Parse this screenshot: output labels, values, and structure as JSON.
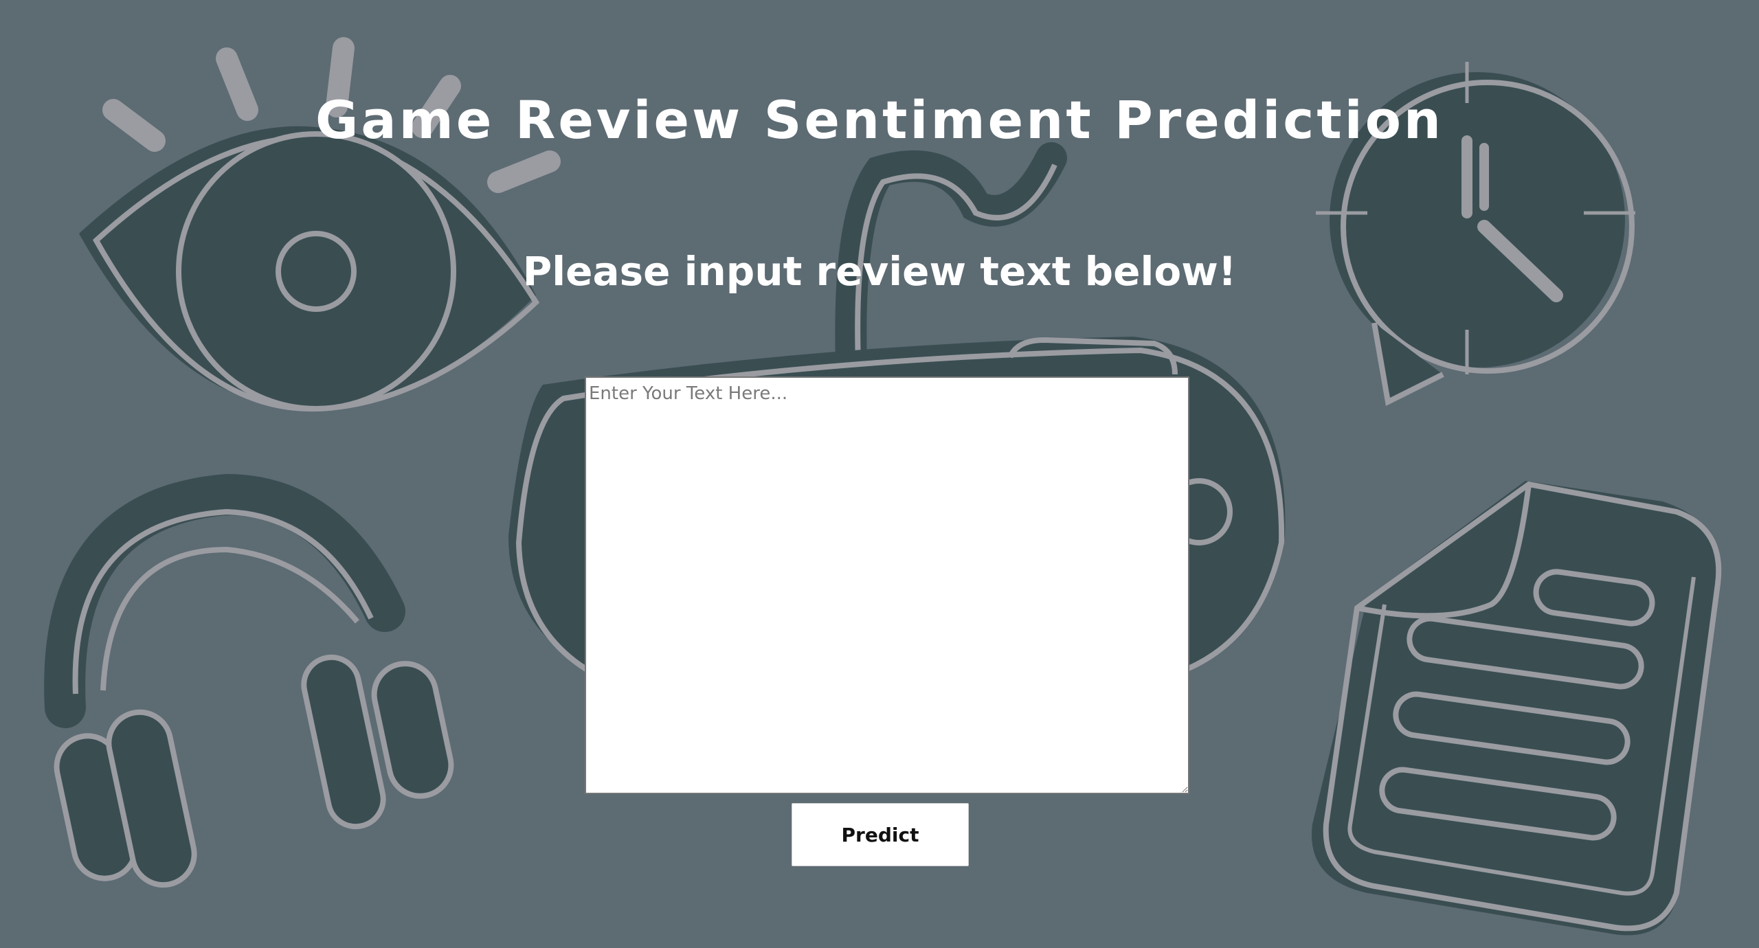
{
  "header": {
    "title": "Game Review Sentiment Prediction",
    "subtitle": "Please input review text below!"
  },
  "form": {
    "review_placeholder": "Enter Your Text Here...",
    "review_value": "",
    "predict_label": "Predict"
  },
  "background": {
    "color": "#5d6b73",
    "icon_fill": "#3a4e52",
    "icon_stroke": "#9a9ca2",
    "icons": [
      "eye-icon",
      "clock-speech-bubble-icon",
      "game-controller-icon",
      "headphones-icon",
      "document-icon"
    ]
  }
}
